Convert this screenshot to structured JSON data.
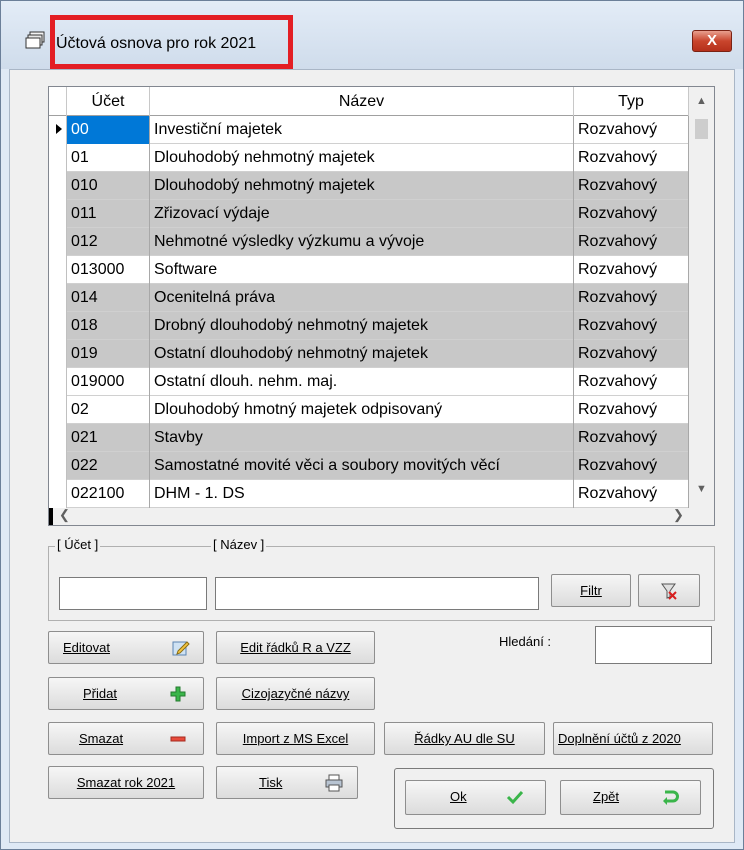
{
  "window": {
    "title": "Účtová osnova pro rok 2021",
    "close_label": "X"
  },
  "grid": {
    "headers": {
      "ucet": "Účet",
      "nazev": "Název",
      "typ": "Typ"
    },
    "rows": [
      {
        "ucet": "00",
        "nazev": "Investiční majetek",
        "typ": "Rozvahový"
      },
      {
        "ucet": "01",
        "nazev": "Dlouhodobý nehmotný majetek",
        "typ": "Rozvahový"
      },
      {
        "ucet": "010",
        "nazev": "Dlouhodobý nehmotný majetek",
        "typ": "Rozvahový"
      },
      {
        "ucet": "011",
        "nazev": "Zřizovací výdaje",
        "typ": "Rozvahový"
      },
      {
        "ucet": "012",
        "nazev": "Nehmotné výsledky výzkumu a vývoje",
        "typ": "Rozvahový"
      },
      {
        "ucet": "013000",
        "nazev": "Software",
        "typ": "Rozvahový"
      },
      {
        "ucet": "014",
        "nazev": "Ocenitelná práva",
        "typ": "Rozvahový"
      },
      {
        "ucet": "018",
        "nazev": "Drobný dlouhodobý nehmotný majetek",
        "typ": "Rozvahový"
      },
      {
        "ucet": "019",
        "nazev": "Ostatní dlouhodobý nehmotný majetek",
        "typ": "Rozvahový"
      },
      {
        "ucet": "019000",
        "nazev": "Ostatní dlouh. nehm. maj.",
        "typ": "Rozvahový"
      },
      {
        "ucet": "02",
        "nazev": "Dlouhodobý hmotný majetek odpisovaný",
        "typ": "Rozvahový"
      },
      {
        "ucet": "021",
        "nazev": "Stavby",
        "typ": "Rozvahový"
      },
      {
        "ucet": "022",
        "nazev": "Samostatné movité věci a soubory movitých věcí",
        "typ": "Rozvahový"
      },
      {
        "ucet": "022100",
        "nazev": "DHM - 1. DS",
        "typ": "Rozvahový"
      }
    ]
  },
  "filter": {
    "ucet_label": "[ Účet ]",
    "nazev_label": "[ Název ]",
    "ucet_value": "",
    "nazev_value": "",
    "filtr_button": "Filtr"
  },
  "search": {
    "label": "Hledání :",
    "value": ""
  },
  "buttons": {
    "editovat": "Editovat",
    "edit_radku": "Edit řádků R a VZZ",
    "pridat": "Přidat",
    "cizojazycne": "Cizojazyčné názvy",
    "smazat": "Smazat",
    "import_excel": "Import z MS Excel",
    "radky_au": "Řádky AU dle SU",
    "doplneni": "Doplnění účtů z 2020",
    "smazat_rok": "Smazat rok 2021",
    "tisk": "Tisk",
    "ok": "Ok",
    "zpet": "Zpět"
  },
  "colors": {
    "selection": "#0078d7",
    "gray_row": "#c8c8c8",
    "highlight_border": "#e31e24"
  }
}
